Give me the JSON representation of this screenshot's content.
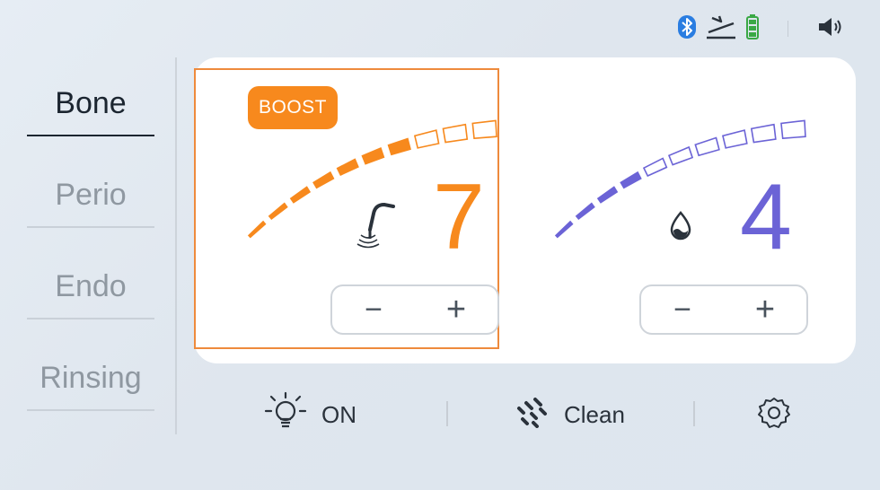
{
  "status": {
    "icons": [
      "bluetooth-icon",
      "foot-pedal-icon",
      "battery-icon",
      "volume-icon"
    ]
  },
  "sidebar": {
    "items": [
      {
        "label": "Bone",
        "active": true
      },
      {
        "label": "Perio",
        "active": false
      },
      {
        "label": "Endo",
        "active": false
      },
      {
        "label": "Rinsing",
        "active": false
      }
    ]
  },
  "power": {
    "badge": "BOOST",
    "value": "7",
    "level": 7,
    "max": 10,
    "icon": "handpiece-icon",
    "minus": "−",
    "plus": "+"
  },
  "water": {
    "value": "4",
    "level": 4,
    "max": 10,
    "icon": "water-drop-icon",
    "minus": "−",
    "plus": "+"
  },
  "bottom": {
    "light_label": "ON",
    "clean_label": "Clean",
    "icons": [
      "light-bulb-icon",
      "spray-icon",
      "settings-gear-icon"
    ]
  },
  "colors": {
    "power": "#f7891d",
    "water": "#6b63d6",
    "text": "#1b2530",
    "muted": "#8f98a1"
  }
}
